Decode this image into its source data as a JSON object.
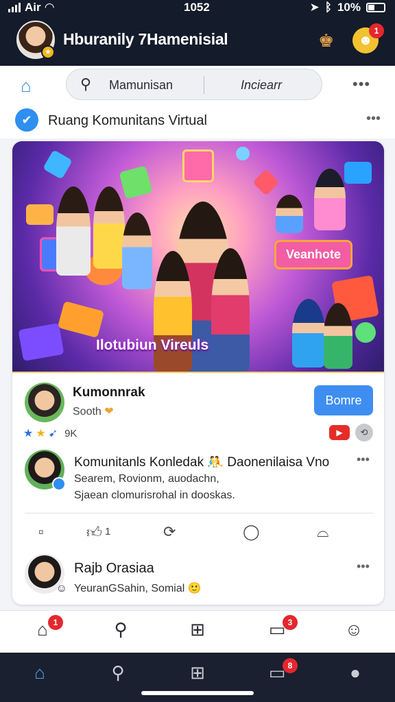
{
  "status_bar": {
    "carrier": "Air",
    "time": "1052",
    "battery": "10%"
  },
  "header": {
    "title": "Hburanily 7Hamenisial",
    "notification_count": "1"
  },
  "search": {
    "placeholder": "Mamunisan",
    "filter_label": "Inciearr"
  },
  "community": {
    "label": "Ruang Komunitans Virtual"
  },
  "banner": {
    "tag_text": "Veanhote",
    "title_text": "Ilotubiun Vireuls"
  },
  "author": {
    "name": "Kumonnrak",
    "subtitle": "Sooth",
    "follow_label": "Bomre",
    "rating_count": "9K"
  },
  "post": {
    "title": "Komunitanls Konledak 🤼 Daonenilaisa Vno",
    "line1": "Searem, Rovionm, auodachn,",
    "line2": "Sjaean clomurisrohal in dooskas."
  },
  "actions": {
    "like_count": "1"
  },
  "comment": {
    "name": "Rajb Orasiaa",
    "text": "YeuranGSahin, Somial 🙂"
  },
  "nav_badges": {
    "home": "1",
    "inbox": "3"
  },
  "nav2_badges": {
    "inbox": "8"
  },
  "colors": {
    "accent": "#3e8ef1",
    "header_bg": "#141b2a",
    "badge": "#e4282d"
  }
}
